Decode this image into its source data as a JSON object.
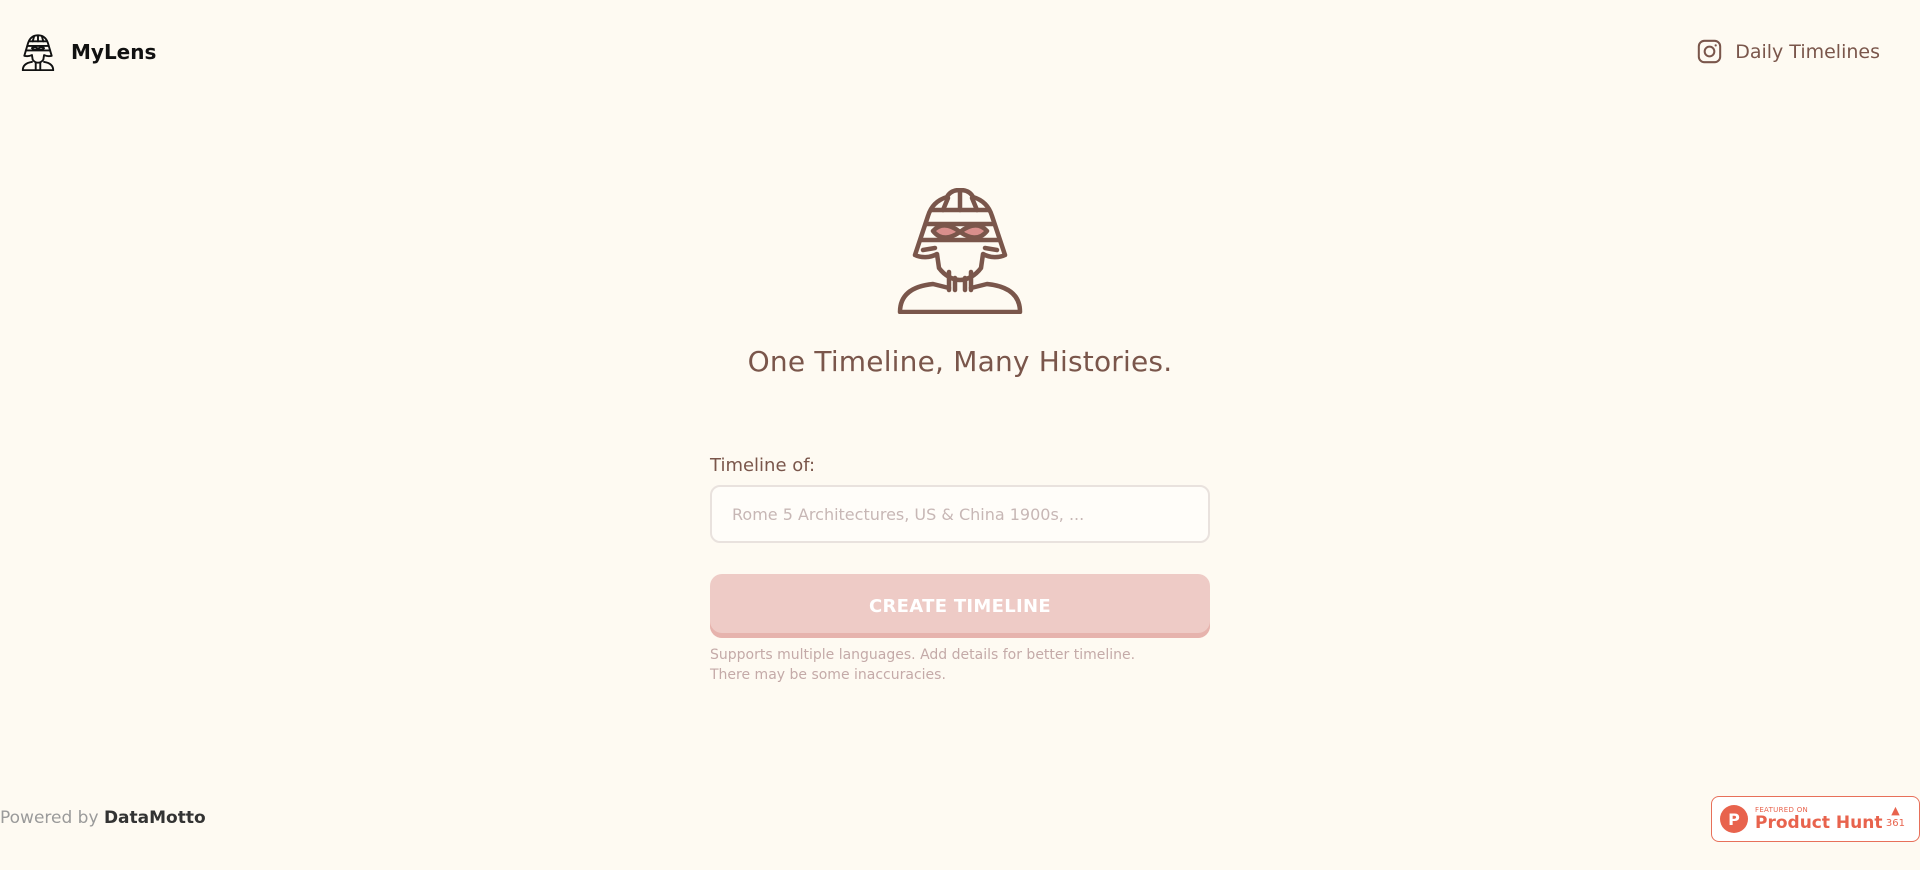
{
  "header": {
    "brand": {
      "name": "MyLens",
      "icon": "pharaoh-avatar-icon"
    },
    "nav": {
      "label": "Daily Timelines",
      "icon": "instagram-icon"
    }
  },
  "hero": {
    "icon": "pharaoh-infinity-icon",
    "tagline": "One Timeline, Many Histories."
  },
  "form": {
    "label": "Timeline of:",
    "input": {
      "value": "",
      "placeholder": "Rome 5 Architectures, US & China 1900s, ..."
    },
    "button": "CREATE TIMELINE",
    "hint": [
      "Supports multiple languages. Add details for better timeline.",
      "There may be some inaccuracies."
    ]
  },
  "footer": {
    "powered_prefix": "Powered by",
    "powered_brand": "DataMotto",
    "badge": {
      "logo": "P",
      "featured": "FEATURED ON",
      "name": "Product Hunt",
      "votes": "361",
      "icon": "upvote-arrow-icon"
    }
  },
  "colors": {
    "background": "#fefaf2",
    "brown": "#7a564b",
    "button": "#eecbc6",
    "accent": "#e8634d"
  }
}
